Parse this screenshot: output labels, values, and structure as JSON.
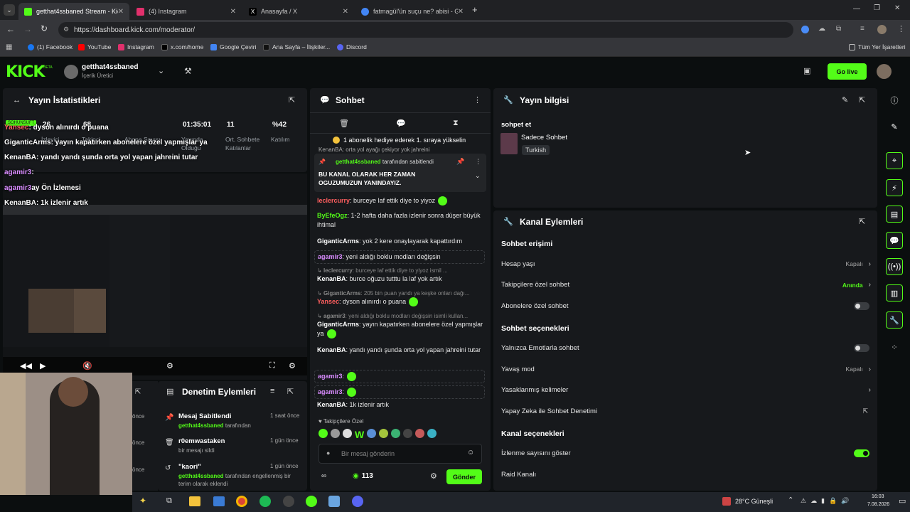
{
  "browser": {
    "tabs": [
      {
        "label": "getthat4ssbaned Stream - Kick",
        "color": "#53fc18"
      },
      {
        "label": "(4) Instagram",
        "color": "#e1306c"
      },
      {
        "label": "Anasayfa / X",
        "color": "#000000"
      },
      {
        "label": "fatmagül'ün suçu ne? abisi - Go",
        "color": "#4285f4"
      }
    ],
    "url": "https://dashboard.kick.com/moderator/",
    "bookmarks": [
      "(1) Facebook",
      "YouTube",
      "Instagram",
      "x.com/home",
      "Google Çeviri",
      "Ana Sayfa – İlişkiler...",
      "Discord"
    ],
    "all_bookmarks": "Tüm Yer İşaretleri"
  },
  "header": {
    "logo": "KICK",
    "logo_badge": "BETA",
    "channel_name": "getthat4ssbaned",
    "channel_role": "İçerik Üretici",
    "golive_label": "Go live"
  },
  "stats": {
    "title": "Yayın İstatistikleri",
    "values": [
      {
        "value": "26",
        "label": "İzleyici"
      },
      {
        "value": "68",
        "label": "Takipçi"
      },
      {
        "value": "",
        "label": "Abone Sayısı"
      },
      {
        "value": "01:35:01",
        "label": "Yayında Olduğu"
      },
      {
        "value": "11",
        "label": "Ort. Sohbete Katılanlar"
      },
      {
        "value": "%42",
        "label": "Katılım"
      }
    ],
    "live_badge": "SOHUNSUFT"
  },
  "overlay_chat": [
    {
      "user": "Yansec",
      "text": ": dyson alınırdı o puana"
    },
    {
      "user": "GiganticArms",
      "text": ": yayın kapatırken abonelere özel yapmışlar ya"
    },
    {
      "user": "KenanBA",
      "text": ": yandı yandı şunda orta yol yapan jahreini tutar"
    },
    {
      "user": "agamir3",
      "text": ":"
    },
    {
      "user": "agamir3",
      "text": "ay Ön İzlemesi"
    },
    {
      "user": "KenanBA",
      "text": ": 1k izlenir artık"
    }
  ],
  "modlog": {
    "title": "Denetim Eylemleri",
    "items": [
      {
        "title": "Mesaj Sabitlendi",
        "time": "1 saat önce",
        "by": "getthat4ssbaned",
        "desc": "tarafından"
      },
      {
        "title": "r0emwastaken",
        "time": "1 gün önce",
        "by": "",
        "desc": "bir mesajı sildi"
      },
      {
        "title": "\"kaori\"",
        "time": "1 gün önce",
        "by": "getthat4ssbaned",
        "desc": "tarafından engellenmiş bir terim olarak eklendi"
      }
    ],
    "partial_times": [
      "önce",
      "önce",
      "önce"
    ]
  },
  "chat": {
    "title": "Sohbet",
    "gift_banner": "1 abonelik hediye ederek 1. sıraya yükselin",
    "cut_msg": "KenanBA: orta yol ayağı çekiyor yok jahreini",
    "pinned_by": "getthat4ssbaned",
    "pinned_by_suffix": "tarafından sabitlendi",
    "pinned_text": "BU KANAL OLARAK HER ZAMAN OGUZUMUZUN YANINDAYIZ.",
    "messages": [
      {
        "user": "leclercurry",
        "color": "#ff5f5f",
        "text": ": burceye laf ettik diye to yiyoz"
      },
      {
        "user": "ByEfeOgz",
        "color": "#53fc18",
        "text": ": 1-2 hafta daha fazla izlenir sonra düşer büyük ihtimal"
      },
      {
        "user": "GiganticArms",
        "color": "#ffffff",
        "text": ": yok 2 kere onaylayarak kapattırdım"
      },
      {
        "user": "agamir3",
        "color": "#d98cff",
        "text": ": yeni aldığı boklu modları değişsin"
      },
      {
        "user": "leclercurry",
        "color": "#888888",
        "text": ": burceye laf ettik diye to yiyoz  ismil ..."
      },
      {
        "user": "KenanBA",
        "color": "#ffffff",
        "text": ": burce oğuzu tutttu la laf yok artık"
      },
      {
        "user": "GiganticArms",
        "color": "#888888",
        "text": ": 205 bin puan yandı ya keşke onları dağı..."
      },
      {
        "user": "Yansec",
        "color": "#ff5f5f",
        "text": ": dyson alınırdı o puana"
      },
      {
        "user": "agamir3",
        "color": "#888888",
        "text": ": yeni aldığı boklu modları değişsin isimli kullan..."
      },
      {
        "user": "GiganticArms",
        "color": "#ffffff",
        "text": ": yayın kapatırken abonelere özel yapmışlar ya"
      },
      {
        "user": "KenanBA",
        "color": "#ffffff",
        "text": ": yandı yandı şunda orta yol yapan jahreini tutar"
      },
      {
        "user": "agamir3",
        "color": "#d98cff",
        "text": ":"
      },
      {
        "user": "agamir3",
        "color": "#d98cff",
        "text": ":"
      },
      {
        "user": "KenanBA",
        "color": "#ffffff",
        "text": ": 1k izlenir artık"
      }
    ],
    "emote_label": "Takipçilere Özel",
    "input_placeholder": "Bir mesaj gönderin",
    "points": "113",
    "send_label": "Gönder"
  },
  "stream_info": {
    "title": "Yayın bilgisi",
    "heading": "sohpet et",
    "category": "Sadece Sohbet",
    "language": "Turkish"
  },
  "channel_actions": {
    "title": "Kanal Eylemleri",
    "sections": [
      {
        "heading": "Sohbet erişimi",
        "rows": [
          {
            "label": "Hesap yaşı",
            "value": "Kapalı",
            "kind": "chevron"
          },
          {
            "label": "Takipçilere özel sohbet",
            "value": "Anında",
            "kind": "chevron"
          },
          {
            "label": "Abonelere özel sohbet",
            "value": "",
            "kind": "toggle-off"
          }
        ]
      },
      {
        "heading": "Sohbet seçenekleri",
        "rows": [
          {
            "label": "Yalnızca Emotlarla sohbet",
            "value": "",
            "kind": "toggle-off"
          },
          {
            "label": "Yavaş mod",
            "value": "Kapalı",
            "kind": "chevron"
          },
          {
            "label": "Yasaklanmış kelimeler",
            "value": "",
            "kind": "chevron"
          },
          {
            "label": "Yapay Zeka ile Sohbet Denetimi",
            "value": "",
            "kind": "external"
          }
        ]
      },
      {
        "heading": "Kanal seçenekleri",
        "rows": [
          {
            "label": "İzlenme sayısını göster",
            "value": "",
            "kind": "toggle-on"
          },
          {
            "label": "Raid Kanalı",
            "value": "",
            "kind": "none"
          }
        ]
      }
    ]
  },
  "taskbar": {
    "weather": "28°C  Güneşli",
    "time": "16:03",
    "date": "7.08.2026"
  },
  "colors": {
    "accent": "#53fc18",
    "panel": "#17191c",
    "bg": "#0b0e0f"
  }
}
